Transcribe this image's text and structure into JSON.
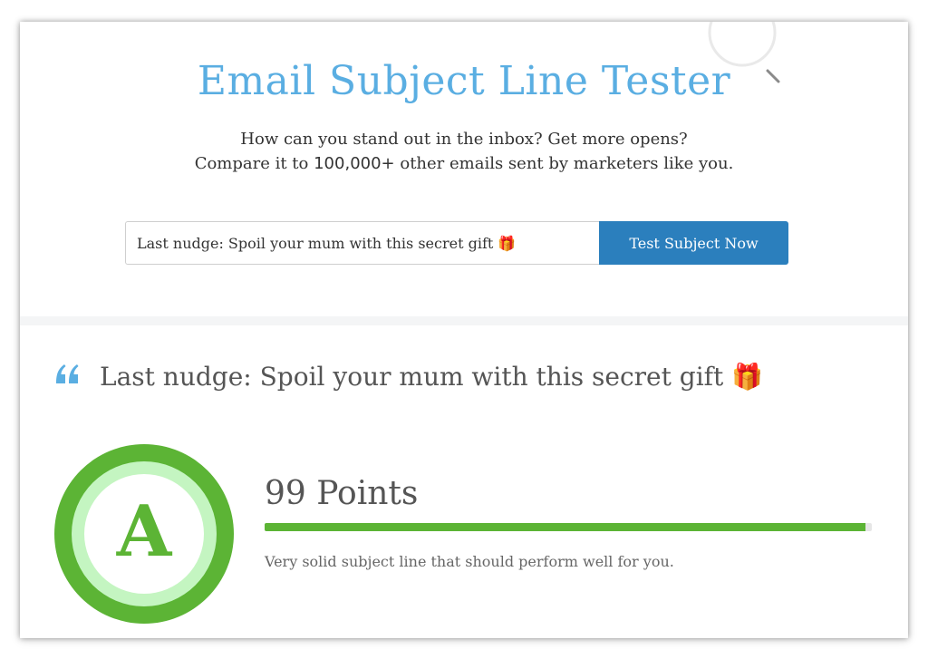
{
  "hero": {
    "title": "Email Subject Line Tester",
    "subtitle_line1": "How can you stand out in the inbox? Get more opens?",
    "subtitle_line2_prefix": "Compare it to ",
    "subtitle_line2_number": "100,000+",
    "subtitle_line2_suffix": " other emails sent by marketers like you.",
    "decoration_icon": "magnifier-icon"
  },
  "form": {
    "subject_value": "Last nudge: Spoil your mum with this secret gift 🎁",
    "button_label": "Test Subject Now"
  },
  "result": {
    "quote_icon": "quote-icon",
    "subject": "Last nudge: Spoil your mum with this secret gift 🎁",
    "grade": "A",
    "points_label": "99 Points",
    "score_fraction": 0.99,
    "description": "Very solid subject line that should perform well for you."
  },
  "colors": {
    "title_blue": "#5aaee2",
    "button_blue": "#2b7fbd",
    "grade_green": "#5cb435",
    "grade_light_green": "#c4f5c1"
  }
}
